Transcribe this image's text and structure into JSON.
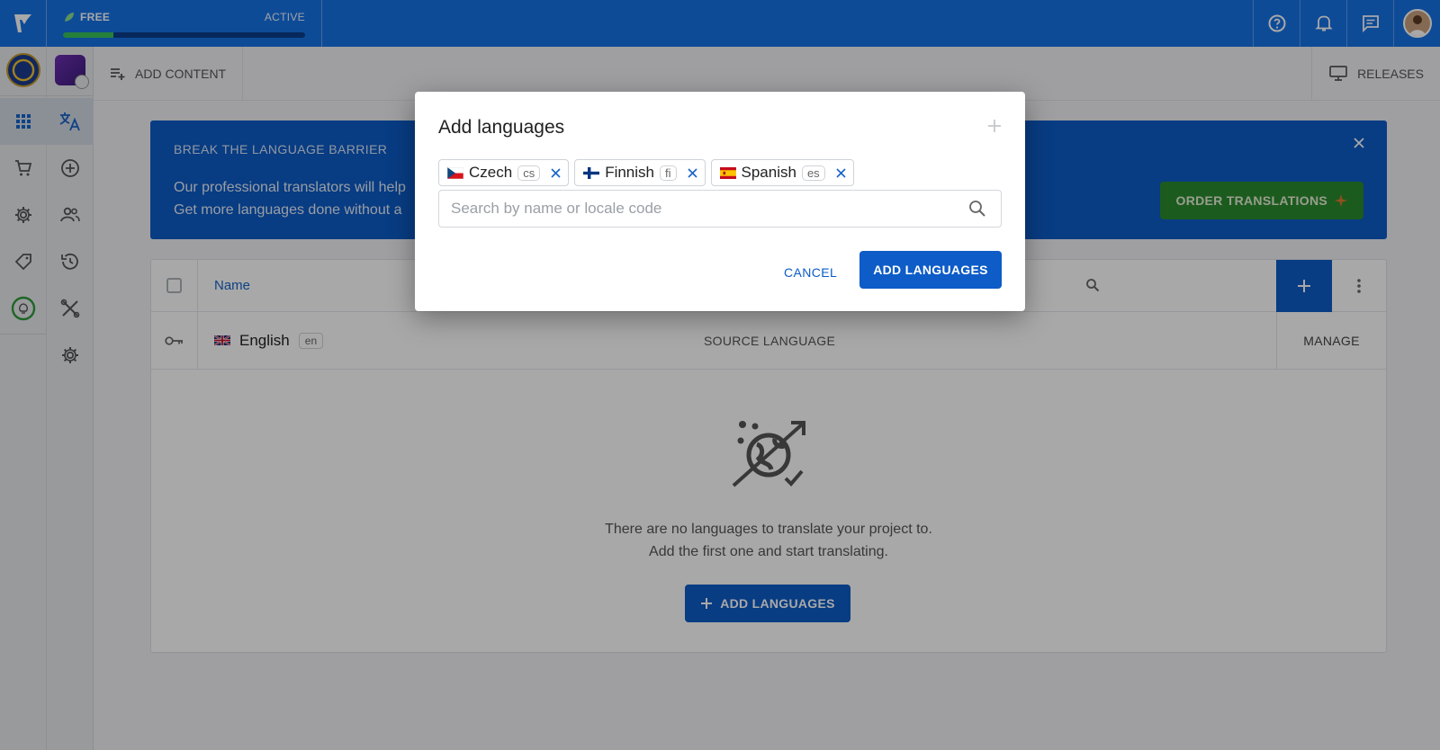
{
  "topbar": {
    "plan_label": "FREE",
    "plan_status": "ACTIVE",
    "plan_progress": 0.21
  },
  "subheader": {
    "add_content": "ADD CONTENT",
    "releases": "RELEASES"
  },
  "banner": {
    "title": "BREAK THE LANGUAGE BARRIER",
    "line1": "Our professional translators will help",
    "line2": "Get more languages done without a",
    "order_button": "ORDER TRANSLATIONS"
  },
  "table": {
    "col_name": "Name",
    "rows": [
      {
        "name": "English",
        "code": "en",
        "role": "SOURCE LANGUAGE",
        "action": "MANAGE"
      }
    ]
  },
  "empty_state": {
    "line1": "There are no languages to translate your project to.",
    "line2": "Add the first one and start translating.",
    "button": "ADD LANGUAGES"
  },
  "modal": {
    "title": "Add languages",
    "chips": [
      {
        "name": "Czech",
        "code": "cs"
      },
      {
        "name": "Finnish",
        "code": "fi"
      },
      {
        "name": "Spanish",
        "code": "es"
      }
    ],
    "search_placeholder": "Search by name or locale code",
    "search_value": "",
    "cancel": "CANCEL",
    "confirm": "ADD LANGUAGES"
  },
  "colors": {
    "brand": "#1672e6",
    "primary": "#0d5cc7",
    "success": "#2b8a2e"
  }
}
